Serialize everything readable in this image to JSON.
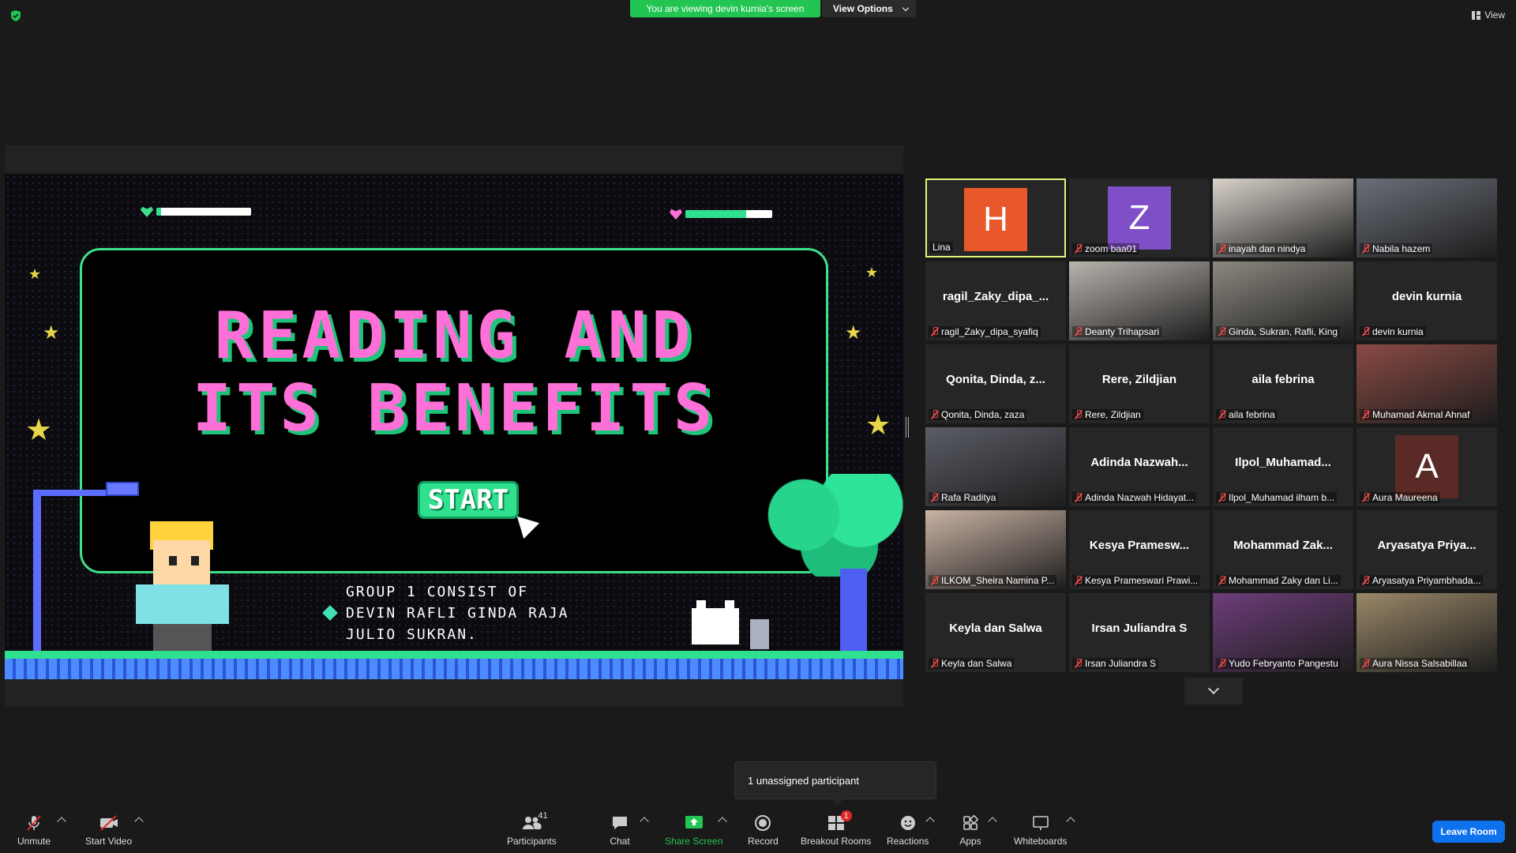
{
  "top": {
    "banner": "You are viewing devin kurnia's screen",
    "view_options": "View Options",
    "view": "View"
  },
  "slide": {
    "title_line1": "READING AND",
    "title_line2": "ITS BENEFITS",
    "start": "START",
    "group_line1": "GROUP 1 CONSIST OF",
    "group_line2": "DEVIN RAFLI GINDA RAJA",
    "group_line3": "JULIO SUKRAN.",
    "health_left": 0.05,
    "health_right": 0.7
  },
  "participants": [
    {
      "label": "Lina",
      "avatar": "H",
      "avatar_color": "#e8582a",
      "active": true,
      "muted": false
    },
    {
      "label": "zoom baa01",
      "avatar": "Z",
      "avatar_color": "#7e4fc7",
      "muted": true
    },
    {
      "label": "inayah dan nindya",
      "video": true,
      "video_color": "#d8d2ca",
      "muted": true
    },
    {
      "label": "Nabila hazem",
      "video": true,
      "video_color": "#6a6f78",
      "muted": true
    },
    {
      "name": "ragil_Zaky_dipa_...",
      "label": "ragil_Zaky_dipa_syafiq",
      "muted": true
    },
    {
      "label": "Deanty Trihapsari",
      "video": true,
      "video_color": "#b9b3ad",
      "muted": true
    },
    {
      "label": "Ginda, Sukran, Rafli, King",
      "video": true,
      "video_color": "#8c8880",
      "muted": true
    },
    {
      "name": "devin kurnia",
      "label": "devin kurnia",
      "muted": true
    },
    {
      "name": "Qonita, Dinda, z...",
      "label": "Qonita, Dinda, zaza",
      "muted": true
    },
    {
      "name": "Rere, Zildjian",
      "label": "Rere, Zildjian",
      "muted": true
    },
    {
      "name": "aila febrina",
      "label": "aila febrina",
      "muted": true
    },
    {
      "label": "Muhamad Akmal Ahnaf",
      "video": true,
      "video_color": "#8a4a44",
      "muted": true
    },
    {
      "label": "Rafa Raditya",
      "video": true,
      "video_color": "#5b5d66",
      "muted": true
    },
    {
      "name": "Adinda Nazwah...",
      "label": "Adinda Nazwah Hidayat...",
      "muted": true
    },
    {
      "name": "Ilpol_Muhamad...",
      "label": "Ilpol_Muhamad ilham b...",
      "muted": true
    },
    {
      "label": "Aura Maureena",
      "avatar": "A",
      "avatar_color": "#5a2a26",
      "muted": true
    },
    {
      "label": "ILKOM_Sheira Namina P...",
      "video": true,
      "video_color": "#c9b3a4",
      "muted": true
    },
    {
      "name": "Kesya Pramesw...",
      "label": "Kesya Prameswari Prawi...",
      "muted": true
    },
    {
      "name": "Mohammad Zak...",
      "label": "Mohammad Zaky dan Li...",
      "muted": true
    },
    {
      "name": "Aryasatya Priya...",
      "label": "Aryasatya Priyambhada...",
      "muted": true
    },
    {
      "name": "Keyla dan Salwa",
      "label": "Keyla dan Salwa",
      "muted": true
    },
    {
      "name": "Irsan Juliandra S",
      "label": "Irsan Juliandra S",
      "muted": true
    },
    {
      "label": "Yudo Febryanto Pangestu",
      "video": true,
      "video_color": "#6d3d7a",
      "muted": true
    },
    {
      "label": "Aura Nissa Salsabillaa",
      "video": true,
      "video_color": "#9a8868",
      "muted": true
    }
  ],
  "tooltip": "1 unassigned participant",
  "toolbar": {
    "unmute": "Unmute",
    "start_video": "Start Video",
    "participants": "Participants",
    "participants_count": "41",
    "chat": "Chat",
    "share_screen": "Share Screen",
    "record": "Record",
    "breakout_rooms": "Breakout Rooms",
    "breakout_badge": "1",
    "reactions": "Reactions",
    "apps": "Apps",
    "whiteboards": "Whiteboards",
    "leave": "Leave Room"
  }
}
